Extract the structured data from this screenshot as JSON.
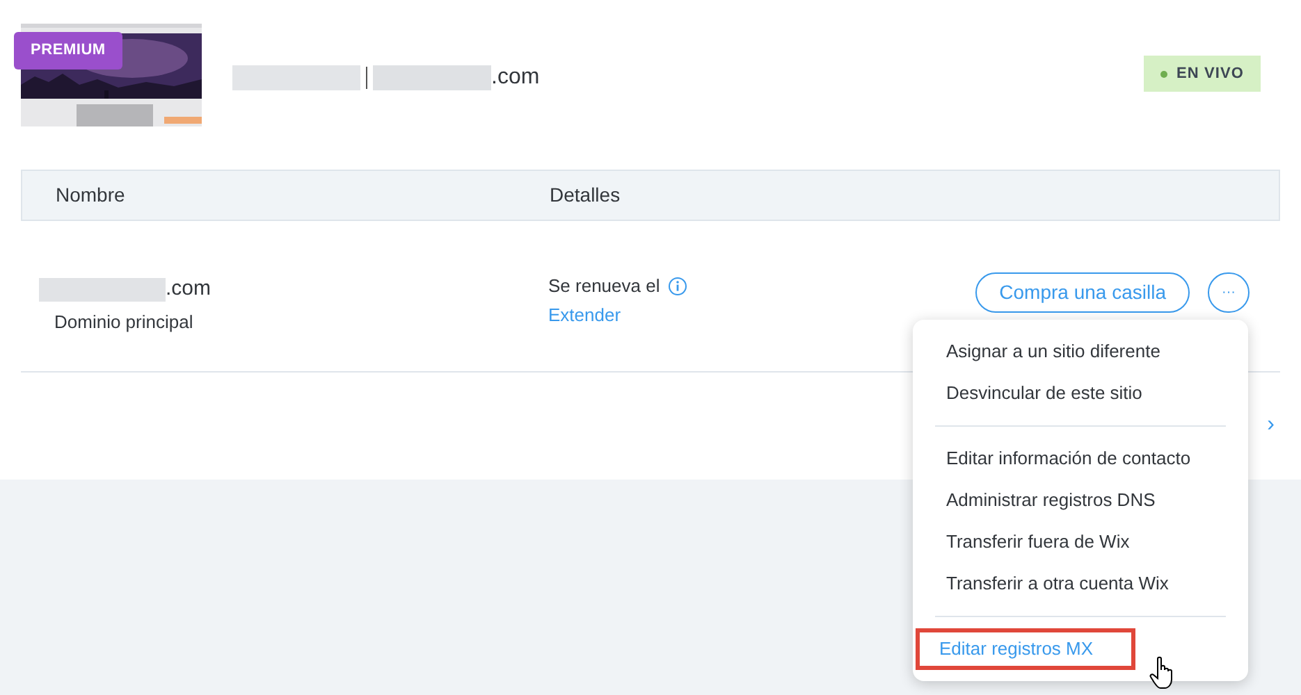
{
  "site": {
    "badge": "PREMIUM",
    "domain_suffix": ".com",
    "status": {
      "label": "EN VIVO",
      "color": "#6fae4f"
    }
  },
  "table": {
    "columns": [
      "Nombre",
      "Detalles"
    ],
    "rows": [
      {
        "domain_suffix": ".com",
        "domain_type": "Dominio principal",
        "details": "Se renueva el",
        "action_link": "Extender",
        "button": "Compra una casilla",
        "more_button": "···"
      }
    ]
  },
  "pager": {
    "next": "›"
  },
  "menu": {
    "groups": [
      [
        {
          "label": "Asignar a un sitio diferente",
          "selected": false
        },
        {
          "label": "Desvincular de este sitio",
          "selected": false
        }
      ],
      [
        {
          "label": "Editar información de contacto",
          "selected": false
        },
        {
          "label": "Administrar registros DNS",
          "selected": false
        },
        {
          "label": "Transferir fuera de Wix",
          "selected": false
        },
        {
          "label": "Transferir a otra cuenta Wix",
          "selected": false
        }
      ],
      [
        {
          "label": "Editar registros MX",
          "selected": true
        }
      ]
    ]
  }
}
